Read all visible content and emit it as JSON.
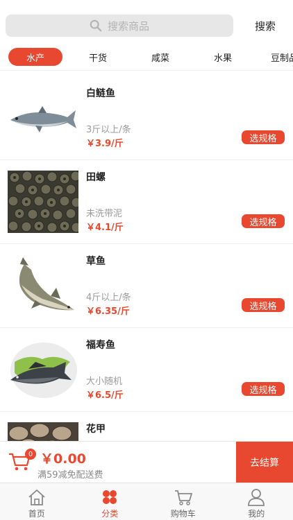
{
  "search": {
    "placeholder": "搜索商品",
    "button_label": "搜索"
  },
  "tabs": [
    {
      "label": "水产",
      "active": true
    },
    {
      "label": "干货",
      "active": false
    },
    {
      "label": "咸菜",
      "active": false
    },
    {
      "label": "水果",
      "active": false
    },
    {
      "label": "豆制品",
      "active": false
    }
  ],
  "products": [
    {
      "name": "白鲢鱼",
      "spec": "3斤以上/条",
      "price": "￥3.9/斤",
      "button": "选规格",
      "image": "silver-carp"
    },
    {
      "name": "田螺",
      "spec": "未洗带泥",
      "price": "￥4.1/斤",
      "button": "选规格",
      "image": "river-snails"
    },
    {
      "name": "草鱼",
      "spec": "4斤以上/条",
      "price": "￥6.35/斤",
      "button": "选规格",
      "image": "grass-carp"
    },
    {
      "name": "福寿鱼",
      "spec": "大小随机",
      "price": "￥6.5/斤",
      "button": "选规格",
      "image": "tilapia"
    },
    {
      "name": "花甲",
      "spec": "",
      "price": "",
      "button": "",
      "image": "clams"
    }
  ],
  "cart": {
    "badge_count": "0",
    "total": "￥0.00",
    "note": "满59减免配送费",
    "checkout_label": "去结算"
  },
  "nav": [
    {
      "label": "首页",
      "icon": "home-icon",
      "active": false
    },
    {
      "label": "分类",
      "icon": "category-icon",
      "active": true
    },
    {
      "label": "购物车",
      "icon": "cart-icon",
      "active": false
    },
    {
      "label": "我的",
      "icon": "user-icon",
      "active": false
    }
  ],
  "colors": {
    "accent": "#e8482f",
    "muted": "#9a9a9a",
    "background": "#ffffff"
  }
}
